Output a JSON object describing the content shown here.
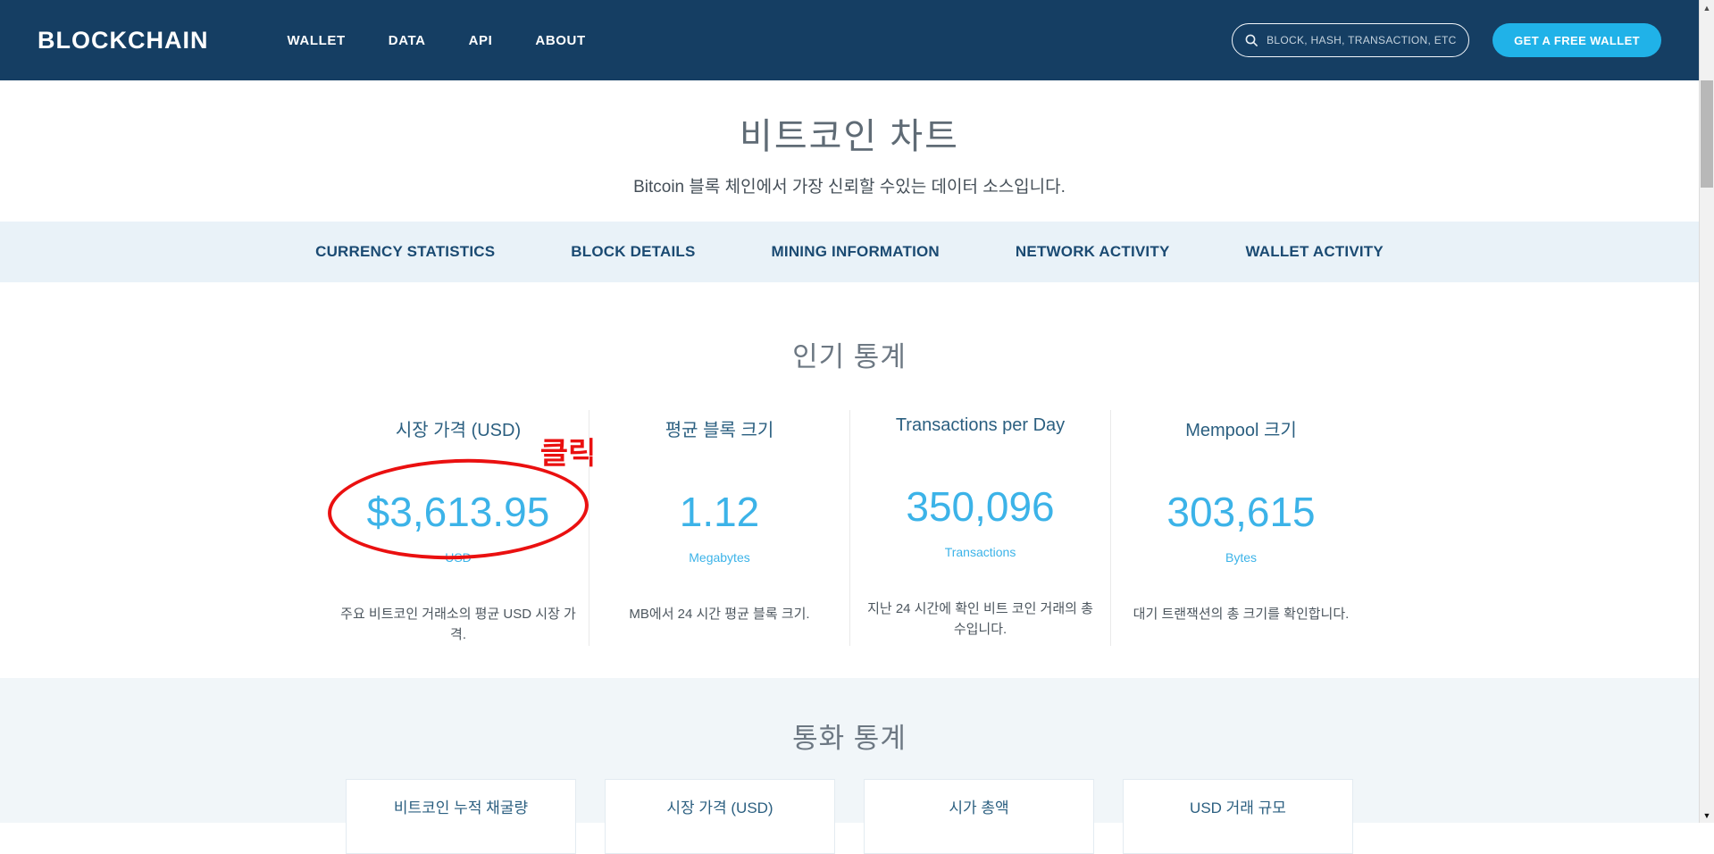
{
  "navbar": {
    "logo": "BLOCKCHAIN",
    "items": [
      {
        "label": "WALLET"
      },
      {
        "label": "DATA"
      },
      {
        "label": "API"
      },
      {
        "label": "ABOUT"
      }
    ],
    "search": {
      "placeholder": "BLOCK, HASH, TRANSACTION, ETC..."
    },
    "wallet_button": "GET A FREE WALLET"
  },
  "hero": {
    "title": "비트코인 차트",
    "subtitle": "Bitcoin 블록 체인에서 가장 신뢰할 수있는 데이터 소스입니다."
  },
  "tabs": [
    {
      "label": "CURRENCY STATISTICS"
    },
    {
      "label": "BLOCK DETAILS"
    },
    {
      "label": "MINING INFORMATION"
    },
    {
      "label": "NETWORK ACTIVITY"
    },
    {
      "label": "WALLET ACTIVITY"
    }
  ],
  "popular_stats": {
    "title": "인기 통계",
    "stats": [
      {
        "label": "시장 가격 (USD)",
        "value": "$3,613.95",
        "unit": "USD",
        "description": "주요 비트코인 거래소의 평균 USD 시장 가격."
      },
      {
        "label": "평균 블록 크기",
        "value": "1.12",
        "unit": "Megabytes",
        "description": "MB에서 24 시간 평균 블록 크기."
      },
      {
        "label": "Transactions per Day",
        "value": "350,096",
        "unit": "Transactions",
        "description": "지난 24 시간에 확인 비트 코인 거래의 총 수입니다."
      },
      {
        "label": "Mempool 크기",
        "value": "303,615",
        "unit": "Bytes",
        "description": "대기 트랜잭션의 총 크기를 확인합니다."
      }
    ]
  },
  "annotation": {
    "label": "클릭"
  },
  "currency_stats": {
    "title": "통화 통계",
    "cards": [
      {
        "label": "비트코인 누적 채굴량"
      },
      {
        "label": "시장 가격 (USD)"
      },
      {
        "label": "시가 총액"
      },
      {
        "label": "USD 거래 규모"
      }
    ]
  },
  "icons": {
    "scroll_up": "▲",
    "scroll_down": "▼"
  },
  "colors": {
    "navbar_navy": "#153e63",
    "accent_blue": "#3cb3e8",
    "button_blue": "#20b2e8",
    "tab_band_blue": "#e9f2f8",
    "heading_gray": "#6d7883",
    "label_navy": "#2b5f80",
    "section_bg": "#f1f6f9",
    "annotation_red": "#ea1010"
  }
}
